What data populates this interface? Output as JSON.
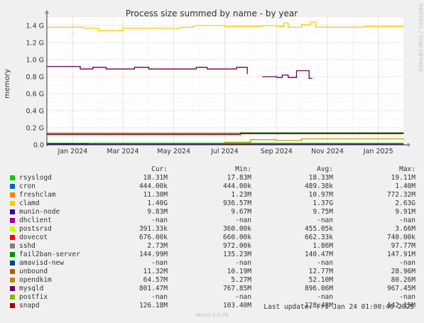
{
  "chart_data": {
    "type": "line",
    "title": "Process size summed by name - by year",
    "ylabel": "memory",
    "ylim": [
      0,
      1.5
    ],
    "yunit": "G",
    "ytick_values": [
      0.0,
      0.2,
      0.4,
      0.6,
      0.8,
      1.0,
      1.2,
      1.4
    ],
    "ytick_labels": [
      "0.0",
      "0.2 G",
      "0.4 G",
      "0.6 G",
      "0.8 G",
      "1.0 G",
      "1.2 G",
      "1.4 G"
    ],
    "xlim": [
      "2023-12-01",
      "2025-01-31"
    ],
    "xtick_dates": [
      "2024-01-01",
      "2024-03-01",
      "2024-05-01",
      "2024-07-01",
      "2024-09-01",
      "2024-11-01",
      "2025-01-01"
    ],
    "xtick_labels": [
      "Jan 2024",
      "Mar 2024",
      "May 2024",
      "Jul 2024",
      "Sep 2024",
      "Nov 2024",
      "Jan 2025"
    ],
    "grid": true,
    "series": [
      {
        "name": "clamd",
        "color": "#ffcc00",
        "points": [
          [
            "2023-12-01",
            1.38
          ],
          [
            "2024-01-15",
            1.37
          ],
          [
            "2024-02-01",
            1.34
          ],
          [
            "2024-03-01",
            1.37
          ],
          [
            "2024-04-15",
            1.37
          ],
          [
            "2024-05-10",
            1.38
          ],
          [
            "2024-05-25",
            1.4
          ],
          [
            "2024-07-01",
            1.39
          ],
          [
            "2024-08-15",
            1.4
          ],
          [
            "2024-09-01",
            1.39
          ],
          [
            "2024-09-10",
            1.43
          ],
          [
            "2024-09-15",
            1.38
          ],
          [
            "2024-10-01",
            1.41
          ],
          [
            "2024-10-12",
            1.44
          ],
          [
            "2024-10-18",
            1.38
          ],
          [
            "2024-11-15",
            1.38
          ],
          [
            "2024-12-15",
            1.39
          ],
          [
            "2025-01-31",
            1.39
          ]
        ]
      },
      {
        "name": "mysqld",
        "color": "#660066",
        "points": [
          [
            "2023-12-01",
            0.92
          ],
          [
            "2024-01-05",
            0.92
          ],
          [
            "2024-01-10",
            0.89
          ],
          [
            "2024-01-20",
            0.89
          ],
          [
            "2024-01-25",
            0.91
          ],
          [
            "2024-02-10",
            0.89
          ],
          [
            "2024-03-10",
            0.89
          ],
          [
            "2024-03-15",
            0.91
          ],
          [
            "2024-04-01",
            0.89
          ],
          [
            "2024-05-20",
            0.89
          ],
          [
            "2024-05-28",
            0.91
          ],
          [
            "2024-06-10",
            0.89
          ],
          [
            "2024-07-05",
            0.89
          ],
          [
            "2024-07-15",
            0.91
          ],
          [
            "2024-07-28",
            0.83
          ],
          [
            "2024-08-10",
            null
          ],
          [
            "2024-08-15",
            0.8
          ],
          [
            "2024-09-01",
            0.79
          ],
          [
            "2024-09-08",
            0.82
          ],
          [
            "2024-09-15",
            0.79
          ],
          [
            "2024-09-25",
            0.87
          ],
          [
            "2024-10-08",
            0.87
          ],
          [
            "2024-10-10",
            0.78
          ],
          [
            "2024-10-14",
            0.78
          ]
        ]
      },
      {
        "name": "fail2ban-server",
        "color": "#006600",
        "points": [
          [
            "2023-12-01",
            0.135
          ],
          [
            "2024-07-01",
            0.135
          ],
          [
            "2024-07-20",
            0.14
          ],
          [
            "2025-01-31",
            0.145
          ]
        ]
      },
      {
        "name": "snapd",
        "color": "#990000",
        "points": [
          [
            "2023-12-01",
            0.12
          ],
          [
            "2024-07-01",
            0.12
          ],
          [
            "2024-07-20",
            0.13
          ],
          [
            "2025-01-31",
            0.13
          ]
        ]
      },
      {
        "name": "opendkim",
        "color": "#cc9900",
        "points": [
          [
            "2023-12-01",
            0.02
          ],
          [
            "2024-07-01",
            0.03
          ],
          [
            "2024-08-01",
            0.06
          ],
          [
            "2024-09-01",
            0.05
          ],
          [
            "2024-10-01",
            0.07
          ],
          [
            "2025-01-31",
            0.06
          ]
        ]
      },
      {
        "name": "rsyslogd",
        "color": "#00cc00",
        "points": [
          [
            "2023-12-01",
            0.018
          ],
          [
            "2025-01-31",
            0.018
          ]
        ]
      },
      {
        "name": "freshclam",
        "color": "#ff8000",
        "points": [
          [
            "2023-12-01",
            0.011
          ],
          [
            "2025-01-31",
            0.011
          ]
        ]
      },
      {
        "name": "unbound",
        "color": "#cc6600",
        "points": [
          [
            "2023-12-01",
            0.012
          ],
          [
            "2025-01-31",
            0.012
          ]
        ]
      },
      {
        "name": "munin-node",
        "color": "#330099",
        "points": [
          [
            "2023-12-01",
            0.01
          ],
          [
            "2024-01-15",
            0.01
          ],
          [
            "2024-01-20",
            0.006
          ],
          [
            "2025-01-31",
            0.01
          ]
        ]
      }
    ]
  },
  "legend": {
    "headers": {
      "cur": "Cur:",
      "min": "Min:",
      "avg": "Avg:",
      "max": "Max:"
    },
    "rows": [
      {
        "name": "rsyslogd",
        "color": "#00cc00",
        "cur": "18.31M",
        "min": "17.83M",
        "avg": "18.33M",
        "max": "19.11M"
      },
      {
        "name": "cron",
        "color": "#0066b3",
        "cur": "444.00k",
        "min": "444.00k",
        "avg": "489.38k",
        "max": "1.40M"
      },
      {
        "name": "freshclam",
        "color": "#ff8000",
        "cur": "11.30M",
        "min": "1.23M",
        "avg": "10.97M",
        "max": "772.32M"
      },
      {
        "name": "clamd",
        "color": "#ffcc00",
        "cur": "1.40G",
        "min": "936.57M",
        "avg": "1.37G",
        "max": "2.63G"
      },
      {
        "name": "munin-node",
        "color": "#330099",
        "cur": "9.83M",
        "min": "9.67M",
        "avg": "9.75M",
        "max": "9.91M"
      },
      {
        "name": "dhclient",
        "color": "#990099",
        "cur": "-nan",
        "min": "-nan",
        "avg": "-nan",
        "max": "-nan"
      },
      {
        "name": "postsrsd",
        "color": "#ccff00",
        "cur": "391.33k",
        "min": "360.00k",
        "avg": "455.05k",
        "max": "3.66M"
      },
      {
        "name": "dovecot",
        "color": "#ff0000",
        "cur": "676.00k",
        "min": "660.00k",
        "avg": "662.33k",
        "max": "740.00k"
      },
      {
        "name": "sshd",
        "color": "#808080",
        "cur": "2.73M",
        "min": "972.00k",
        "avg": "1.86M",
        "max": "97.77M"
      },
      {
        "name": "fail2ban-server",
        "color": "#008f00",
        "cur": "144.99M",
        "min": "135.23M",
        "avg": "140.47M",
        "max": "147.91M"
      },
      {
        "name": "amavisd-new",
        "color": "#00487d",
        "cur": "-nan",
        "min": "-nan",
        "avg": "-nan",
        "max": "-nan"
      },
      {
        "name": "unbound",
        "color": "#b35a00",
        "cur": "11.32M",
        "min": "10.19M",
        "avg": "12.77M",
        "max": "28.96M"
      },
      {
        "name": "opendkim",
        "color": "#b38f00",
        "cur": "64.57M",
        "min": "5.27M",
        "avg": "52.10M",
        "max": "80.26M"
      },
      {
        "name": "mysqld",
        "color": "#6b006b",
        "cur": "801.47M",
        "min": "767.85M",
        "avg": "896.06M",
        "max": "967.45M"
      },
      {
        "name": "postfix",
        "color": "#8fb300",
        "cur": "-nan",
        "min": "-nan",
        "avg": "-nan",
        "max": "-nan"
      },
      {
        "name": "snapd",
        "color": "#b30000",
        "cur": "126.18M",
        "min": "103.40M",
        "avg": "128.48M",
        "max": "142.15M"
      }
    ]
  },
  "last_update": "Last update: Fri Jan 24 01:00:46 2025",
  "munin_version": "Munin 2.0.76",
  "side_label": "RRDTOOL / TOBI OETIKER"
}
